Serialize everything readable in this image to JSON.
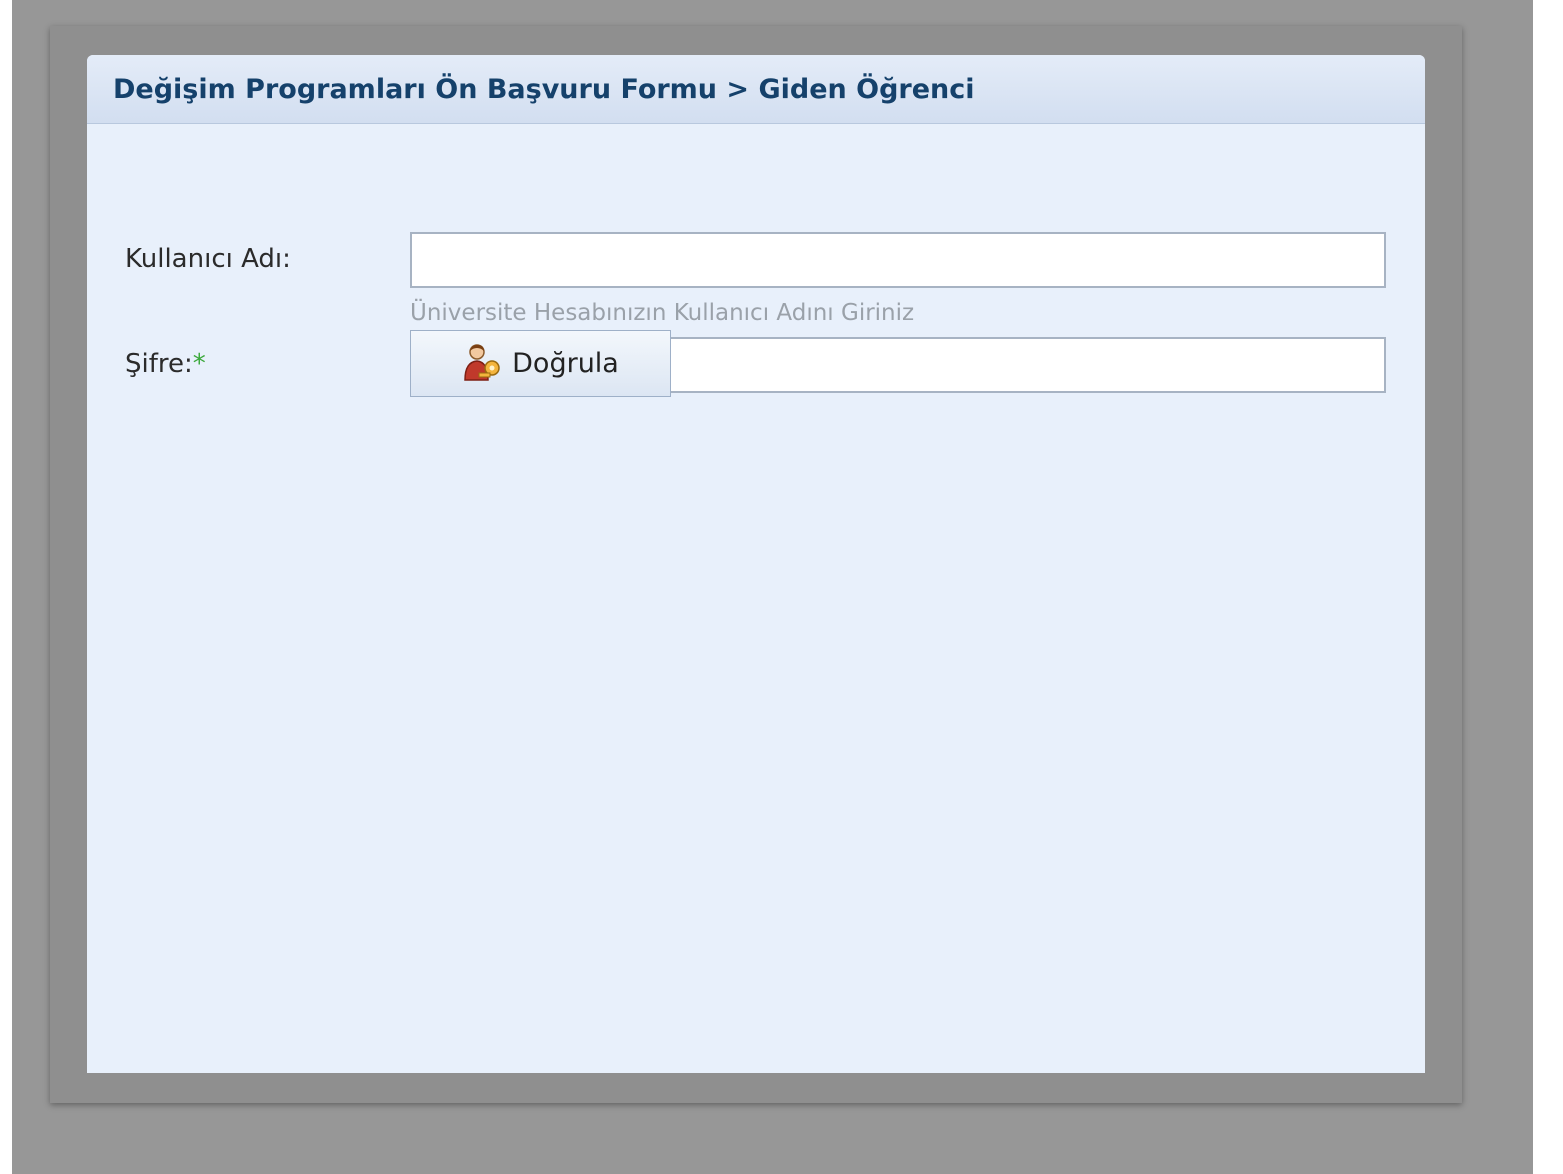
{
  "panel": {
    "title": "Değişim Programları Ön Başvuru Formu > Giden Öğrenci"
  },
  "form": {
    "username": {
      "label": "Kullanıcı Adı:",
      "value": "",
      "hint": "Üniversite Hesabınızın Kullanıcı Adını Giriniz"
    },
    "password": {
      "label": "Şifre:",
      "required_mark": "*",
      "value": ""
    },
    "submit": {
      "label": "Doğrula",
      "icon": "user-key-icon"
    }
  },
  "colors": {
    "title": "#15416b",
    "panel_bg": "#e8f0fb",
    "required": "#3aa83a",
    "hint": "#9aa1a9"
  }
}
